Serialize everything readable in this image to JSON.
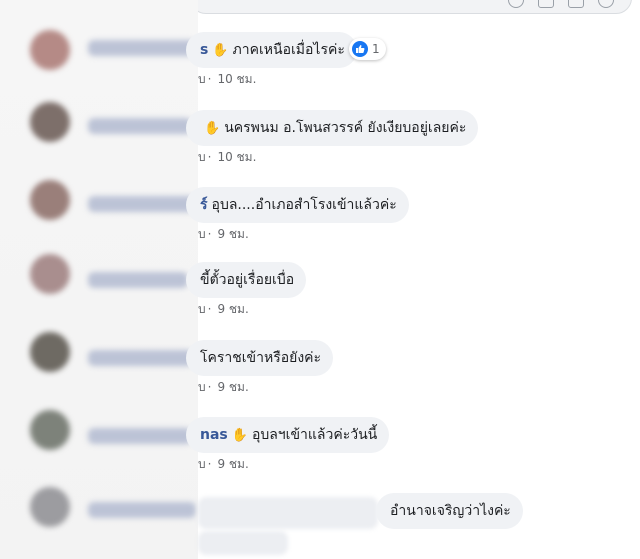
{
  "comments": [
    {
      "name_tail": "s",
      "wave": "✋",
      "text": "ภาคเหนือเมื่อไรค่ะ",
      "meta_prefix": "บ",
      "meta_time": "10 ชม.",
      "reaction": {
        "icon": "like",
        "count": "1"
      }
    },
    {
      "name_tail": "",
      "wave": "✋",
      "text": "นครพนม อ.โพนสวรรค์ ยังเงียบอยู่เลยค่ะ",
      "meta_prefix": "บ",
      "meta_time": "10 ชม."
    },
    {
      "name_tail": "ร์",
      "wave": "",
      "text": "อุบล....อำเภอสำโรงเข้าแล้วค่ะ",
      "meta_prefix": "บ",
      "meta_time": "9 ชม."
    },
    {
      "name_tail": "",
      "wave": "",
      "text": "ขี้ตั้วอยู่เรื่อยเบื่อ",
      "meta_prefix": "บ",
      "meta_time": "9 ชม."
    },
    {
      "name_tail": "",
      "wave": "",
      "text": "โคราชเข้าหรือยังค่ะ",
      "meta_prefix": "บ",
      "meta_time": "9 ชม."
    },
    {
      "name_tail": "nas",
      "wave": "✋",
      "text": "อุบลฯเข้าแล้วค่ะวันนี้",
      "meta_prefix": "บ",
      "meta_time": "9 ชม."
    },
    {
      "name_tail": "",
      "wave": "",
      "text": "อำนาจเจริญว่าไงค่ะ",
      "meta_prefix": "",
      "meta_time": ""
    }
  ],
  "colors": {
    "accent": "#1877f2",
    "name": "#385898",
    "bubble": "#f0f2f5"
  }
}
